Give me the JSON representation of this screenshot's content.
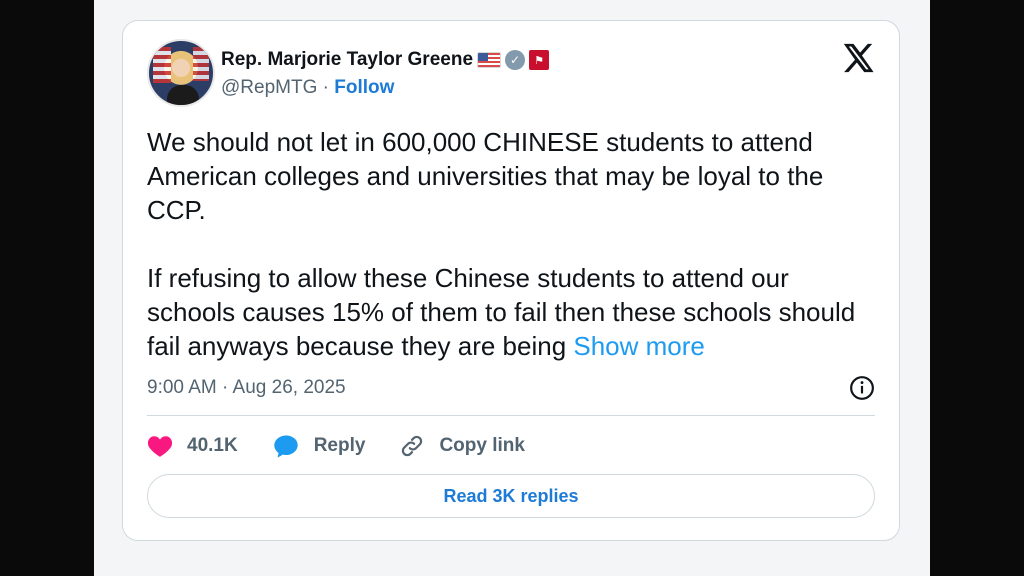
{
  "author": {
    "name": "Rep. Marjorie Taylor Greene",
    "handle": "@RepMTG",
    "separator": " · ",
    "follow_label": "Follow"
  },
  "tweet": {
    "paragraph1": "We should not let in 600,000 CHINESE students to attend American colleges and universities that may be loyal to the CCP.",
    "paragraph2": "If refusing to allow these Chinese students to attend our schools causes 15% of them to fail then these schools should fail anyways because they are being ",
    "show_more": "Show more",
    "timestamp": "9:00 AM · Aug 26, 2025"
  },
  "actions": {
    "likes": "40.1K",
    "reply_label": "Reply",
    "copy_link_label": "Copy link"
  },
  "read_replies_label": "Read 3K replies",
  "icons": [
    "x-logo-icon",
    "verified-badge-icon",
    "us-flag-icon",
    "gov-badge-icon",
    "info-icon",
    "heart-icon",
    "reply-bubble-icon",
    "link-icon"
  ],
  "colors": {
    "accent": "#1d9bf0",
    "link": "#1d7bd6",
    "like": "#f91880",
    "text": "#0f1419",
    "muted": "#536471",
    "border": "#cfd9de"
  }
}
